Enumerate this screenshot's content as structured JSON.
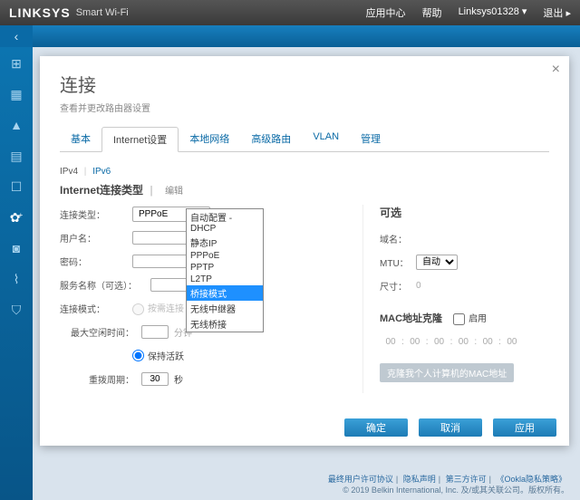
{
  "brand": {
    "logo": "LINKSYS",
    "smart": "Smart Wi-Fi"
  },
  "topnav": {
    "appcenter": "应用中心",
    "help": "帮助",
    "device": "Linksys01328",
    "logout": "退出"
  },
  "modal": {
    "title": "连接",
    "subtitle": "查看并更改路由器设置",
    "close": "×",
    "tabs": [
      "基本",
      "Internet设置",
      "本地网络",
      "高级路由",
      "VLAN",
      "管理"
    ],
    "iptabs": {
      "v4": "IPv4",
      "v6": "IPv6"
    },
    "section": "Internet连接类型",
    "edit": "编辑",
    "left": {
      "type": "连接类型：",
      "type_value": "PPPoE",
      "user": "用户名：",
      "pass": "密码：",
      "service": "服务名称（可选）：",
      "connmode": "连接模式：",
      "ondemand": "按需连接",
      "idle": "最大空闲时间：",
      "idle_unit": "分钟",
      "keepalive": "保持活跃",
      "redial": "重拨周期：",
      "redial_value": "30",
      "redial_unit": "秒"
    },
    "dropdown": [
      "自动配置 - DHCP",
      "静态IP",
      "PPPoE",
      "PPTP",
      "L2TP",
      "桥接模式",
      "无线中继器",
      "无线桥接"
    ],
    "right": {
      "title": "可选",
      "domain": "域名：",
      "mtu": "MTU：",
      "mtu_value": "自动",
      "size": "尺寸：",
      "size_value": "0",
      "mac_title": "MAC地址克隆",
      "enable": "启用",
      "mac_oct": "00",
      "mac_btn": "克隆我个人计算机的MAC地址"
    },
    "buttons": {
      "ok": "确定",
      "cancel": "取消",
      "apply": "应用"
    }
  },
  "footer": {
    "line1_links": [
      "最终用户许可协议",
      "隐私声明",
      "第三方许可",
      "《Ookla隐私策略》"
    ],
    "line2": "© 2019 Belkin International, Inc. 及/或其关联公司。版权所有。"
  }
}
